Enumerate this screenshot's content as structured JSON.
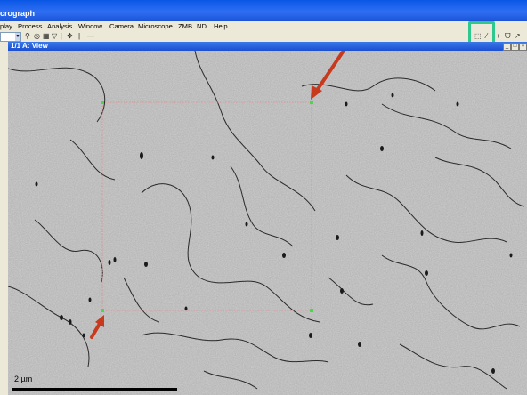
{
  "app": {
    "title": "crograph"
  },
  "menu": [
    "play",
    "Process",
    "Analysis",
    "Window",
    "Camera",
    "Microscope",
    "ZMB",
    "ND",
    "Help"
  ],
  "toolbar": {
    "icons": [
      "zoom-icon",
      "target-icon",
      "grid-icon",
      "filter-icon",
      "move-icon",
      "line-vertical-icon",
      "line-horizontal-icon",
      "dot-icon"
    ]
  },
  "right_toolbar": {
    "icons": [
      "rectangle-select-icon",
      "line-tool-icon",
      "crosshair-icon",
      "lasso-icon",
      "freehand-icon"
    ]
  },
  "view": {
    "title": "1/1 A: View"
  },
  "image": {
    "scale_bar_label": "2 µm"
  },
  "colors": {
    "title_blue": "#1f5ce6",
    "annotation_red": "#c83a1e",
    "highlight_green": "#2ec88e",
    "roi_point_green": "#4cd64c",
    "roi_line_pink": "#e58a8a"
  }
}
